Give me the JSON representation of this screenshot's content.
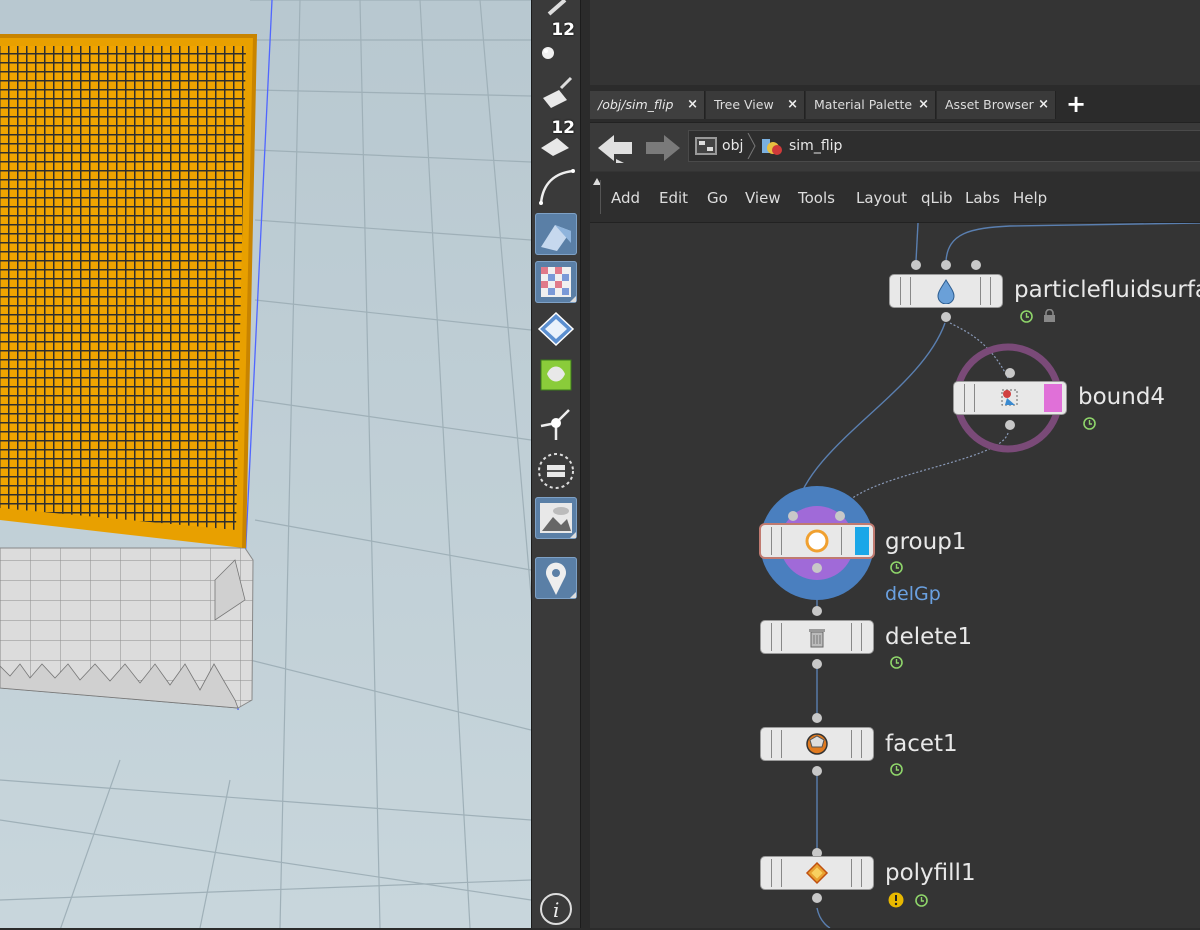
{
  "viewport": {
    "grid_color": "#9fb0b8",
    "mesh_color": "#f0a400"
  },
  "shelf": {
    "tools": [
      {
        "name": "sphere-tool-icon",
        "badge": "12"
      },
      {
        "name": "paint-tool-icon",
        "badge": ""
      },
      {
        "name": "brush-tool-icon",
        "badge": "12"
      },
      {
        "name": "curve-tool-icon",
        "badge": ""
      },
      {
        "name": "select-tool-icon",
        "badge": ""
      },
      {
        "name": "checker-tool-icon",
        "badge": ""
      },
      {
        "name": "diamond-tool-icon",
        "badge": ""
      },
      {
        "name": "uv-tool-icon",
        "badge": ""
      },
      {
        "name": "pivot-tool-icon",
        "badge": ""
      },
      {
        "name": "edit-tool-icon",
        "badge": ""
      },
      {
        "name": "image-tool-icon",
        "badge": ""
      },
      {
        "name": "pin-tool-icon",
        "badge": ""
      },
      {
        "name": "info-icon",
        "badge": ""
      }
    ]
  },
  "tabs": [
    {
      "label": "/obj/sim_flip",
      "close": "×"
    },
    {
      "label": "Tree View",
      "close": "×"
    },
    {
      "label": "Material Palette",
      "close": "×"
    },
    {
      "label": "Asset Browser",
      "close": "×"
    }
  ],
  "add_tab": "+",
  "path": {
    "level1": "obj",
    "level2": "sim_flip"
  },
  "menu": [
    "Add",
    "Edit",
    "Go",
    "View",
    "Tools",
    "Layout",
    "qLib",
    "Labs",
    "Help"
  ],
  "nodes": {
    "particlefluidsurface": "particlefluidsurfa",
    "bound": "bound4",
    "group": "group1",
    "group_sub": "delGp",
    "delete": "delete1",
    "facet": "facet1",
    "polyfill": "polyfill1"
  },
  "colors": {
    "group_ring": "#4a7fbf",
    "group_inner": "#a06ad8",
    "group_flag": "#1aa7e8",
    "bound_ring": "#7a4a78",
    "bound_flag": "#e070d8"
  }
}
